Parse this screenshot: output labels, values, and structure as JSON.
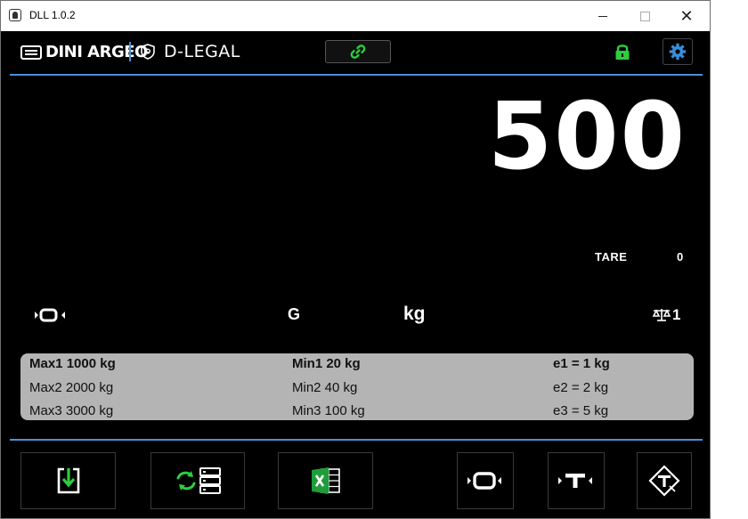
{
  "window": {
    "title": "DLL 1.0.2"
  },
  "header": {
    "brand_dini": "DINI ARGEO",
    "brand_legal": "D-LEGAL",
    "colors": {
      "accent_blue": "#4a90d9",
      "link_green": "#2ecc40",
      "lock_green": "#2ecc40",
      "gear_blue": "#3a8fd8"
    }
  },
  "display": {
    "weight": "500",
    "tare_label": "TARE",
    "tare_value": "0",
    "gross_indicator": "G",
    "unit": "kg",
    "scale_number": "1"
  },
  "info": {
    "rows": [
      [
        "Max1 1000 kg",
        "Min1 20 kg",
        "e1 = 1 kg"
      ],
      [
        "Max2 2000 kg",
        "Min2 40 kg",
        "e2 = 2 kg"
      ],
      [
        "Max3 3000 kg",
        "Min3 100 kg",
        "e3 = 5 kg"
      ]
    ]
  },
  "toolbar": {
    "buttons": [
      "download-icon",
      "sync-database-icon",
      "excel-icon",
      "zero-icon",
      "tare-icon",
      "preset-tare-icon"
    ]
  }
}
